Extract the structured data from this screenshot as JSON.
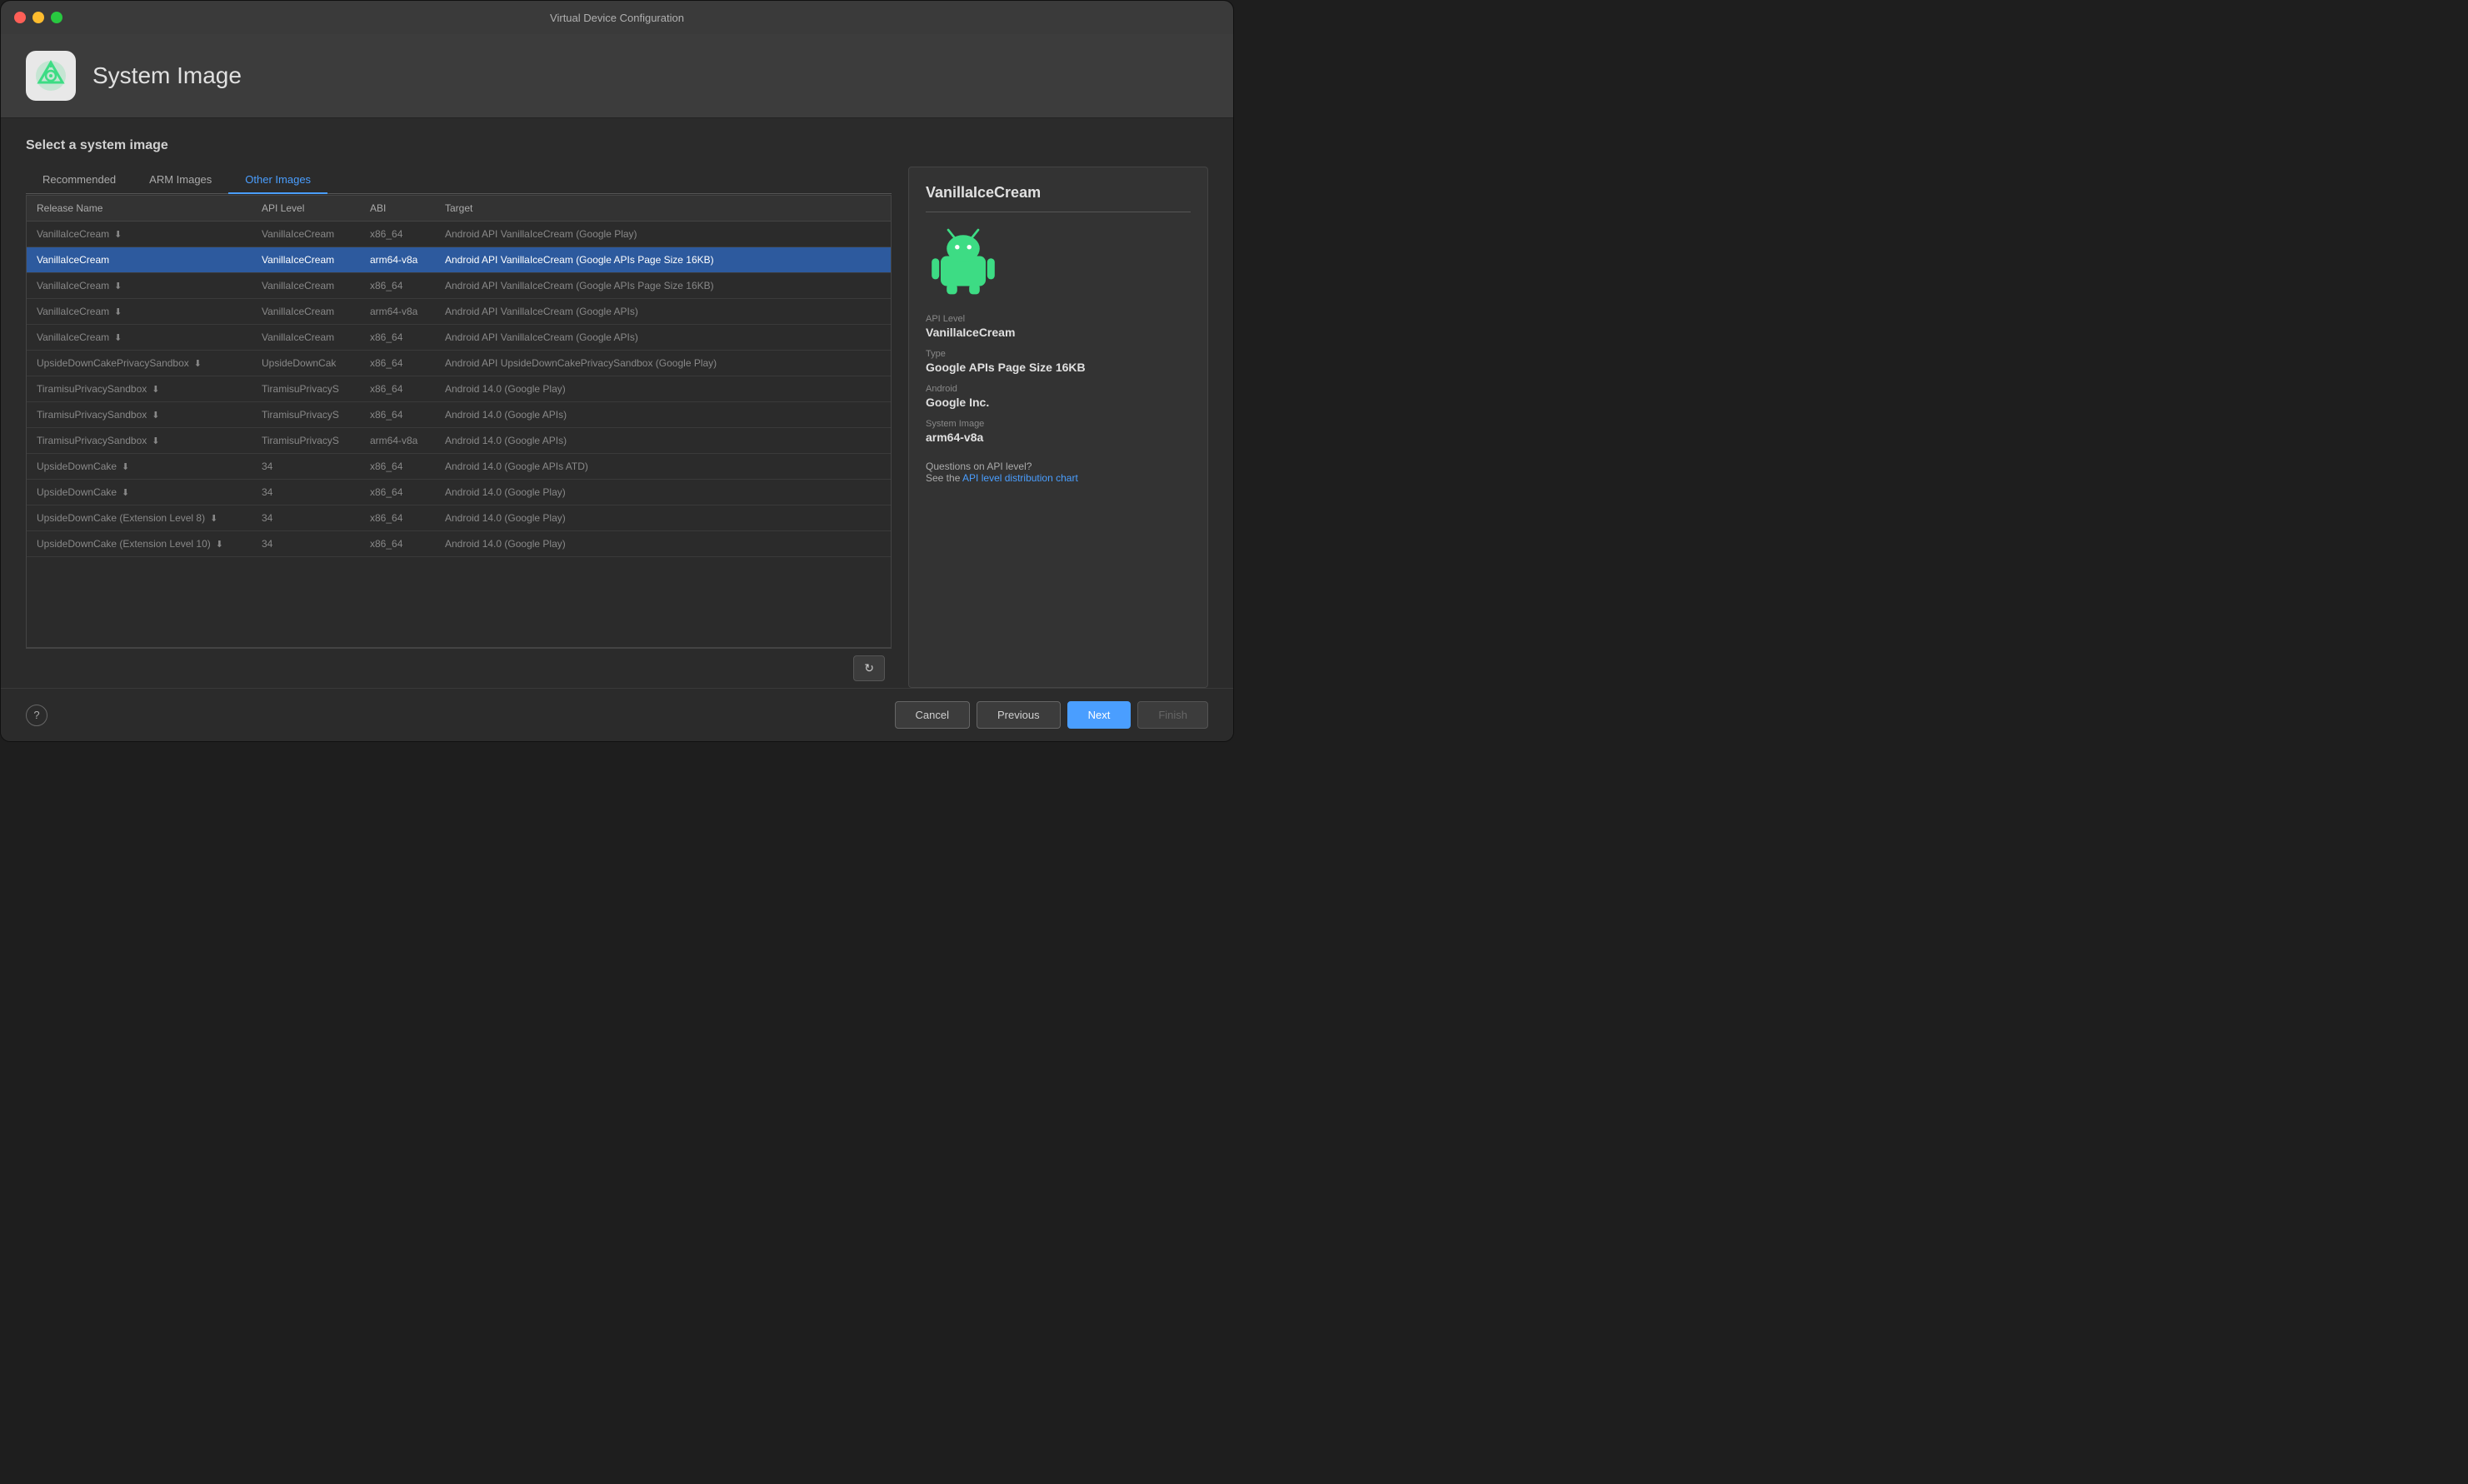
{
  "window": {
    "title": "Virtual Device Configuration"
  },
  "header": {
    "title": "System Image",
    "icon_label": "android-studio-icon"
  },
  "section": {
    "title": "Select a system image"
  },
  "tabs": [
    {
      "label": "Recommended",
      "active": false
    },
    {
      "label": "ARM Images",
      "active": false
    },
    {
      "label": "Other Images",
      "active": true
    }
  ],
  "table": {
    "columns": [
      {
        "label": "Release Name",
        "sort": false
      },
      {
        "label": "API Level",
        "sort": true
      },
      {
        "label": "ABI",
        "sort": false
      },
      {
        "label": "Target",
        "sort": false
      }
    ],
    "rows": [
      {
        "release": "VanillaIceCream",
        "download": true,
        "api": "VanillaIceCream",
        "abi": "x86_64",
        "target": "Android API VanillaIceCream (Google Play)",
        "selected": false
      },
      {
        "release": "VanillaIceCream",
        "download": false,
        "api": "VanillaIceCream",
        "abi": "arm64-v8a",
        "target": "Android API VanillaIceCream (Google APIs Page Size 16KB)",
        "selected": true
      },
      {
        "release": "VanillaIceCream",
        "download": true,
        "api": "VanillaIceCream",
        "abi": "x86_64",
        "target": "Android API VanillaIceCream (Google APIs Page Size 16KB)",
        "selected": false
      },
      {
        "release": "VanillaIceCream",
        "download": true,
        "api": "VanillaIceCream",
        "abi": "arm64-v8a",
        "target": "Android API VanillaIceCream (Google APIs)",
        "selected": false
      },
      {
        "release": "VanillaIceCream",
        "download": true,
        "api": "VanillaIceCream",
        "abi": "x86_64",
        "target": "Android API VanillaIceCream (Google APIs)",
        "selected": false
      },
      {
        "release": "UpsideDownCakePrivacySandbox",
        "download": true,
        "api": "UpsideDownCak",
        "abi": "x86_64",
        "target": "Android API UpsideDownCakePrivacySandbox (Google Play)",
        "selected": false
      },
      {
        "release": "TiramisuPrivacySandbox",
        "download": true,
        "api": "TiramisuPrivacyS",
        "abi": "x86_64",
        "target": "Android 14.0 (Google Play)",
        "selected": false
      },
      {
        "release": "TiramisuPrivacySandbox",
        "download": true,
        "api": "TiramisuPrivacyS",
        "abi": "x86_64",
        "target": "Android 14.0 (Google APIs)",
        "selected": false
      },
      {
        "release": "TiramisuPrivacySandbox",
        "download": true,
        "api": "TiramisuPrivacyS",
        "abi": "arm64-v8a",
        "target": "Android 14.0 (Google APIs)",
        "selected": false
      },
      {
        "release": "UpsideDownCake",
        "download": true,
        "api": "34",
        "abi": "x86_64",
        "target": "Android 14.0 (Google APIs ATD)",
        "selected": false
      },
      {
        "release": "UpsideDownCake",
        "download": true,
        "api": "34",
        "abi": "x86_64",
        "target": "Android 14.0 (Google Play)",
        "selected": false
      },
      {
        "release": "UpsideDownCake (Extension Level 8)",
        "download": true,
        "api": "34",
        "abi": "x86_64",
        "target": "Android 14.0 (Google Play)",
        "selected": false
      },
      {
        "release": "UpsideDownCake (Extension Level 10)",
        "download": true,
        "api": "34",
        "abi": "x86_64",
        "target": "Android 14.0 (Google Play)",
        "selected": false
      }
    ]
  },
  "detail": {
    "title": "VanillaIceCream",
    "api_level_label": "API Level",
    "api_level_value": "VanillaIceCream",
    "type_label": "Type",
    "type_value": "Google APIs Page Size 16KB",
    "android_label": "Android",
    "android_value": "Google Inc.",
    "system_image_label": "System Image",
    "system_image_value": "arm64-v8a",
    "api_question": "Questions on API level?",
    "api_see": "See the",
    "api_link": "API level distribution chart"
  },
  "footer": {
    "help_label": "?",
    "cancel_label": "Cancel",
    "previous_label": "Previous",
    "next_label": "Next",
    "finish_label": "Finish"
  }
}
